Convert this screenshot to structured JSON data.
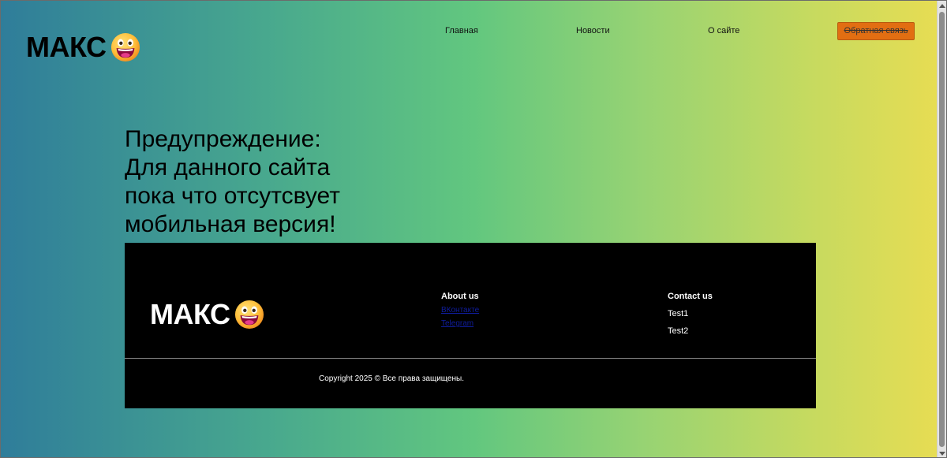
{
  "header": {
    "logo_text": "МАКС",
    "nav": {
      "home": "Главная",
      "news": "Новости",
      "about": "О сайте"
    },
    "feedback_button": "Обратная связь"
  },
  "main": {
    "warning_lines": [
      "Предупреждение:",
      "Для данного сайта",
      "пока что отсутсвует",
      "мобильная версия!"
    ]
  },
  "footer": {
    "logo_text": "МАКС",
    "about": {
      "title": "About us",
      "links": [
        "ВКонтакте",
        "Telegram"
      ]
    },
    "contact": {
      "title": "Contact us",
      "items": [
        "Test1",
        "Test2"
      ]
    },
    "copyright": "Copyright 2025 © Все права защищены."
  },
  "colors": {
    "gradient_start": "#2f7d9a",
    "gradient_mid": "#62c77f",
    "gradient_end": "#e9dd52",
    "button_orange": "#e26e12",
    "footer_bg": "#000000",
    "footer_link": "#0f1d9e"
  },
  "icons": {
    "logo_emoji": "grinning-face-icon"
  }
}
